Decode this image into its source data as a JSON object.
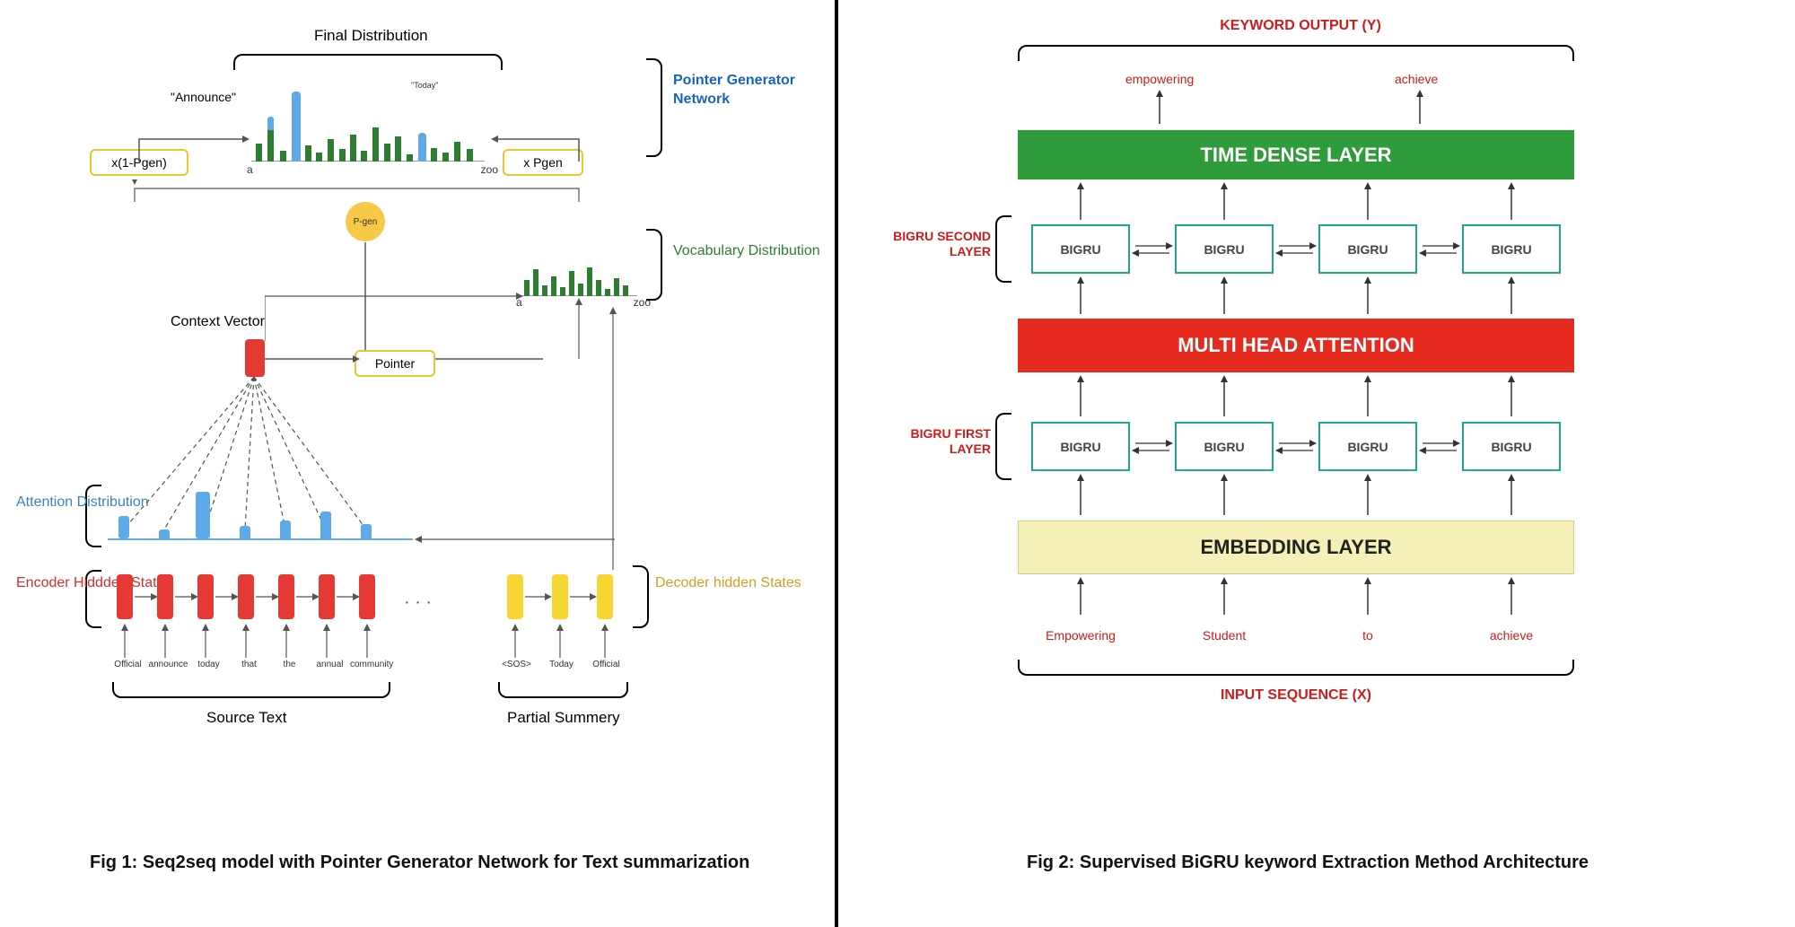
{
  "fig1": {
    "caption": "Fig 1: Seq2seq model with Pointer Generator Network for Text summarization",
    "final_distribution": "Final Distribution",
    "announce": "\"Announce\"",
    "today_small": "\"Today\"",
    "x1pgen": "x(1-Pgen)",
    "xpgen": "x Pgen",
    "pgen": "P-gen",
    "context_vector": "Context Vector",
    "pointer": "Pointer",
    "attention_distribution": "Attention Distribution",
    "encoder_hidden_states": "Encoder Hiddden States",
    "decoder_hidden_states": "Decoder hidden States",
    "source_text": "Source Text",
    "partial_summery": "Partial Summery",
    "pointer_generator_network": "Pointer Generator Network",
    "vocabulary_distribution": "Vocabulary Distribution",
    "a": "a",
    "zoo": "zoo",
    "source_tokens": [
      "Official",
      "announce",
      "today",
      "that",
      "the",
      "annual",
      "community"
    ],
    "decoder_tokens": [
      "<SOS>",
      "Today",
      "Official"
    ]
  },
  "fig2": {
    "caption": "Fig 2: Supervised BiGRU keyword Extraction Method Architecture",
    "keyword_output": "KEYWORD OUTPUT (Y)",
    "time_dense": "TIME DENSE LAYER",
    "bigru_second": "BIGRU SECOND LAYER",
    "multi_head": "MULTI HEAD ATTENTION",
    "bigru_first": "BIGRU FIRST LAYER",
    "embedding": "EMBEDDING LAYER",
    "input_sequence": "INPUT SEQUENCE (X)",
    "bigru": "BIGRU",
    "output_words": [
      "empowering",
      "achieve"
    ],
    "input_words": [
      "Empowering",
      "Student",
      "to",
      "achieve"
    ]
  }
}
